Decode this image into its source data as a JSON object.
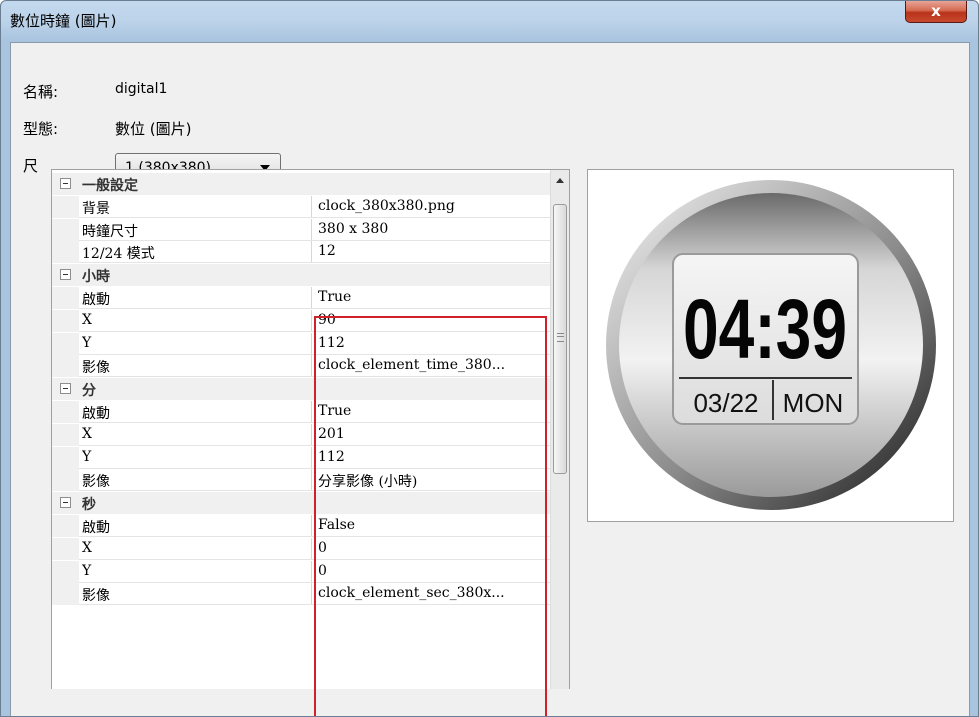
{
  "window": {
    "title": "數位時鐘 (圖片)",
    "close_glyph": "x"
  },
  "form": {
    "name_label": "名稱:",
    "name_value": "digital1",
    "type_label": "型態:",
    "type_value": "數位 (圖片)",
    "size_label": "尺",
    "size_selected": "1  (380x380)"
  },
  "property_grid": {
    "rows": [
      {
        "kind": "category",
        "name": "一般設定",
        "collapse_icon": "minus-box-icon"
      },
      {
        "kind": "prop",
        "name": "背景",
        "value": "clock_380x380.png"
      },
      {
        "kind": "prop",
        "name": "時鐘尺寸",
        "value": "380 x 380"
      },
      {
        "kind": "prop",
        "name": "12/24 模式",
        "value": "12"
      },
      {
        "kind": "category",
        "name": "小時",
        "collapse_icon": "minus-box-icon"
      },
      {
        "kind": "prop",
        "name": "啟動",
        "value": "True"
      },
      {
        "kind": "prop",
        "name": "X",
        "value": "90"
      },
      {
        "kind": "prop",
        "name": "Y",
        "value": "112"
      },
      {
        "kind": "prop",
        "name": "影像",
        "value": "clock_element_time_380..."
      },
      {
        "kind": "category",
        "name": "分",
        "collapse_icon": "minus-box-icon"
      },
      {
        "kind": "prop",
        "name": "啟動",
        "value": "True"
      },
      {
        "kind": "prop",
        "name": "X",
        "value": "201"
      },
      {
        "kind": "prop",
        "name": "Y",
        "value": "112"
      },
      {
        "kind": "prop",
        "name": "影像",
        "value": "分享影像 (小時)"
      },
      {
        "kind": "category",
        "name": "秒",
        "collapse_icon": "minus-box-icon"
      },
      {
        "kind": "prop",
        "name": "啟動",
        "value": "False"
      },
      {
        "kind": "prop",
        "name": "X",
        "value": "0"
      },
      {
        "kind": "prop",
        "name": "Y",
        "value": "0"
      },
      {
        "kind": "prop",
        "name": "影像",
        "value": "clock_element_sec_380x..."
      }
    ]
  },
  "preview": {
    "time": "04:39",
    "date": "03/22",
    "weekday": "MON"
  },
  "colors": {
    "highlight_border": "#d0202a",
    "titlebar": "#a9c4df",
    "close_button": "#c74a2f"
  }
}
